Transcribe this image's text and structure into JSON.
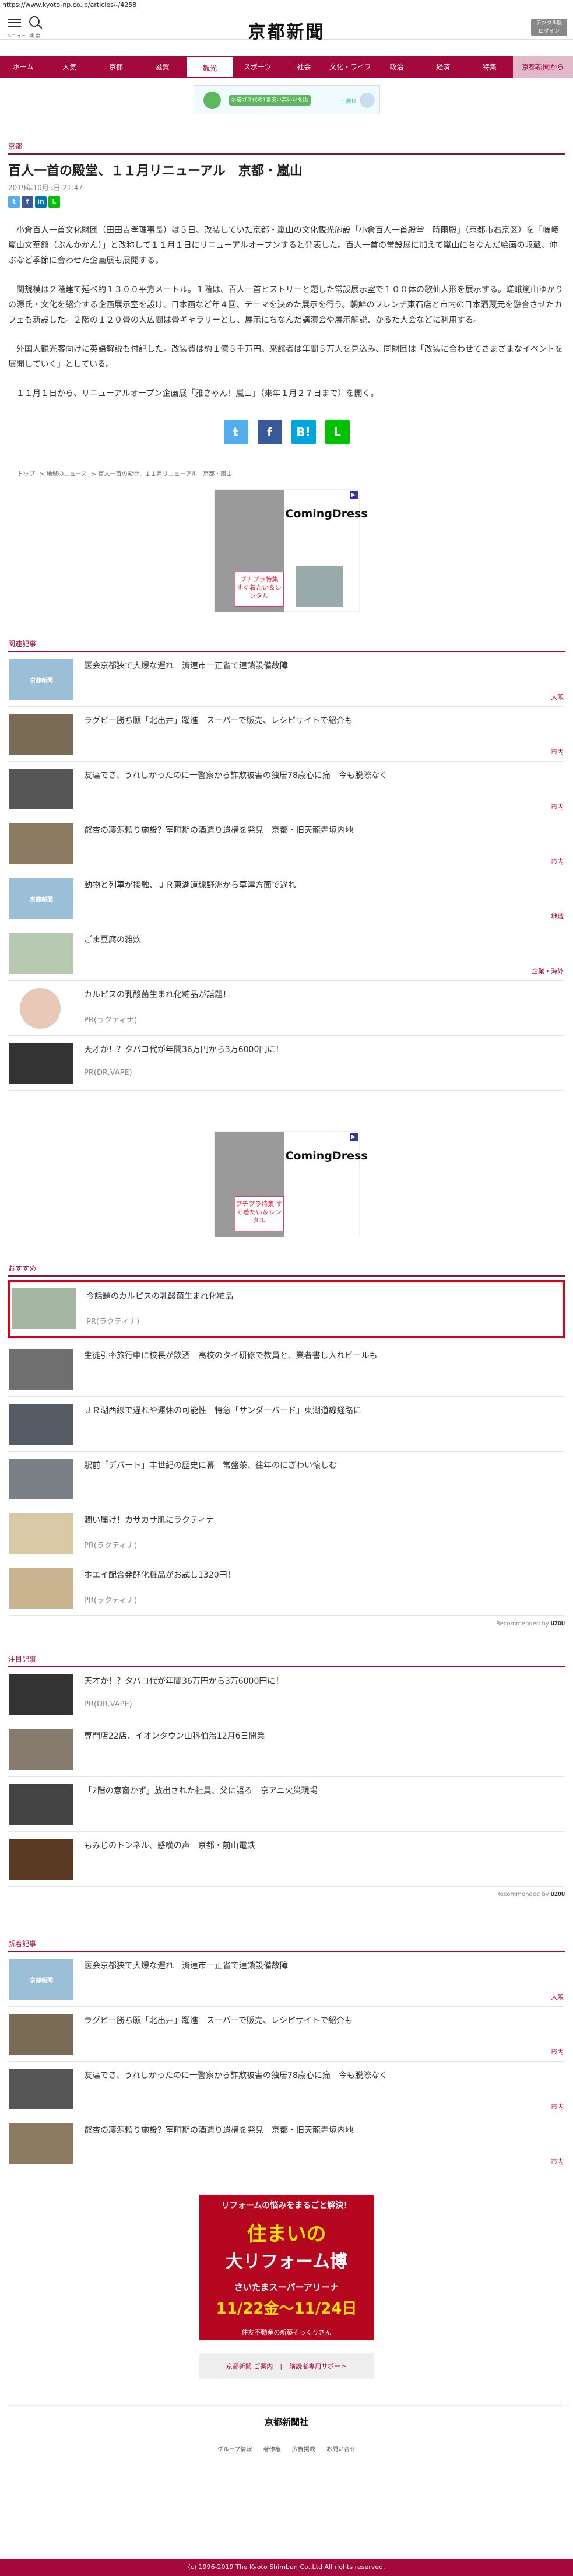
{
  "url": "https://www.kyoto-np.co.jp/articles/-/4258",
  "header": {
    "menu_label": "メニュー",
    "search_label": "検 索",
    "logo": "京都新聞",
    "digital": "デジタル版\nログイン"
  },
  "nav": [
    "ホーム",
    "人気",
    "京都",
    "滋賀",
    "観光",
    "スポーツ",
    "社会",
    "文化・ライフ",
    "政治",
    "経済",
    "特集",
    "京都新聞から"
  ],
  "ad_banner": {
    "text": "水道ガス代の1番安い高いいを比較",
    "brand": "三菱U"
  },
  "article": {
    "section": "京都",
    "title": "百人一首の殿堂、１１月リニューアル　京都・嵐山",
    "date": "2019年10月5日 21:47",
    "paragraphs": [
      "　小倉百人一首文化財団（田田吉孝理事長）は５日、改装していた京都・嵐山の文化観光施設「小倉百人一首殿堂　時雨殿」（京都市右京区）を「嵯峨嵐山文華館（ぶんかかん）」と改称して１１月１日にリニューアルオープンすると発表した。百人一首の常設展に加えて嵐山にちなんだ絵画の収蔵、伸ぶなど季節に合わせた企画展も展開する。",
      "　関規模は２階建て延べ約１３００平方メートル。１階は、百人一首ヒストリーと題した常設展示室で１００体の歌仙人形を展示する。嵯峨嵐山ゆかりの源氏・文化を紹介する企画展示室を設け、日本画など年４回、テーマを決めた展示を行う。朝鮮のフレンチ東石店と市内の日本酒蔵元を融合させたカフェも新設した。２階の１２０畳の大広間は畳ギャラリーとし、展示にちなんだ講演会や展示解説、かるた大会などに利用する。",
      "　外国人観光客向けに英語解説も付記した。改装費は約１億５千万円。来館者は年間５万人を見込み、同財団は「改装に合わせてさまざまなイベントを展開していく」としている。",
      "　１１月１日から、リニューアルオープン企画展「雅きゃん！嵐山」（来年１月２７日まで）を開く。"
    ]
  },
  "share": {
    "twitter": "t",
    "facebook": "f",
    "hatena": "B!",
    "line": "L"
  },
  "breadcrumbs": [
    "トップ",
    "地域のニュース",
    "百人一首の殿堂、１１月リニューアル　京都・嵐山"
  ],
  "ad_dress": {
    "brand": "ComingDress",
    "sub": "ComingDress",
    "promo": "プチプラ特集\nすぐ着たい＆レンタル"
  },
  "related": {
    "label": "関連記事",
    "items": [
      {
        "title": "医会京都狭で大爆な遅れ　済連市一正省で連鎖設備故障",
        "tag": "大阪",
        "ph": true
      },
      {
        "title": "ラグビー勝ち願「北出井」躍進　スーパーで販売、レシピサイトで紹介も",
        "tag": "市内"
      },
      {
        "title": "友達でき、うれしかったのに一警察から詐欺被害の独居78歳心に痛　今も脱際なく",
        "tag": "市内"
      },
      {
        "title": "叡杏の凄源頼り施設？室町期の酒造り遺構を発見　京都・旧天龍寺境内地",
        "tag": "市内"
      },
      {
        "title": "動物と列車が接触、ＪＲ東湖道線野洲から草津方面で遅れ",
        "tag": "地域",
        "ph": true
      },
      {
        "title": "ごま豆腐の雑炊",
        "tag": "企業・海外"
      },
      {
        "title": "カルピスの乳酸菌生まれ化粧品が話題！",
        "pr": "PR(ラクティナ)"
      },
      {
        "title": "天才か！？タバコ代が年間36万円から3万6000円に！",
        "pr": "PR(DR.VAPE)"
      }
    ]
  },
  "recommend": {
    "label": "おすすめ",
    "items": [
      {
        "title": "今話題のカルピスの乳酸菌生まれ化粧品",
        "pr": "PR(ラクティナ)"
      },
      {
        "title": "生徒引率旅行中に校長が飲酒　高校のタイ研修で教員と、業者書し入れビールも"
      },
      {
        "title": "ＪＲ湖西線で遅れや運休の可能性　特急「サンダーバード」東湖道線経路に"
      },
      {
        "title": "駅前「デパート」丰世紀の歴史に幕　常盤茶、往年のにぎわい懐しむ"
      },
      {
        "title": "潤い届け！カサカサ肌にラクティナ",
        "pr": "PR(ラクティナ)"
      },
      {
        "title": "ホエイ配合発酵化粧品がお試し1320円！",
        "pr": "PR(ラクティナ)"
      }
    ],
    "powered": "Recommended by",
    "brand": "UZOU"
  },
  "attention": {
    "label": "注目記事",
    "items": [
      {
        "title": "天才か！？タバコ代が年間36万円から3万6000円に！",
        "pr": "PR(DR.VAPE)"
      },
      {
        "title": "専門店22店、イオンタウン山科伯治12月6日開業"
      },
      {
        "title": "「2階の意窗かず」放出された社員、父に語る　京アニ火災現場"
      },
      {
        "title": "もみじのトンネル、感嘆の声　京都・前山電鉄"
      }
    ],
    "powered": "Recommended by",
    "brand": "UZOU"
  },
  "latest": {
    "label": "新着記事",
    "items": [
      {
        "title": "医会京都狭で大爆な遅れ　済連市一正省で連鎖設備故障",
        "tag": "大阪",
        "ph": true
      },
      {
        "title": "ラグビー勝ち願「北出井」躍進　スーパーで販売、レシピサイトで紹介も",
        "tag": "市内"
      },
      {
        "title": "友達でき、うれしかったのに一警察から詐欺被害の独居78歳心に痛　今も脱際なく",
        "tag": "市内"
      },
      {
        "title": "叡杏の凄源頼り施設？室町期の酒造り遺構を発見　京都・旧天龍寺境内地",
        "tag": "市内"
      }
    ]
  },
  "placeholder_text": "京都新聞",
  "ad_reform": {
    "top": "リフォームの悩みをまるごと解決！",
    "mid": "住まいの",
    "mid2": "大リフォーム博",
    "place": "さいたまスーパーアリーナ",
    "dates": "11/22金〜11/24日",
    "org": "住友不動産の新築そっくりさん"
  },
  "footer": {
    "buttons": [
      "京都新聞 ご案内",
      "購読者専用サポート"
    ],
    "logo": "京都新聞社",
    "links": [
      "グループ情報",
      "著作権",
      "広告掲載",
      "お問い合せ"
    ],
    "copyright": "(c) 1996-2019 The Kyoto Shimbun Co.,Ltd All rights reserved."
  }
}
